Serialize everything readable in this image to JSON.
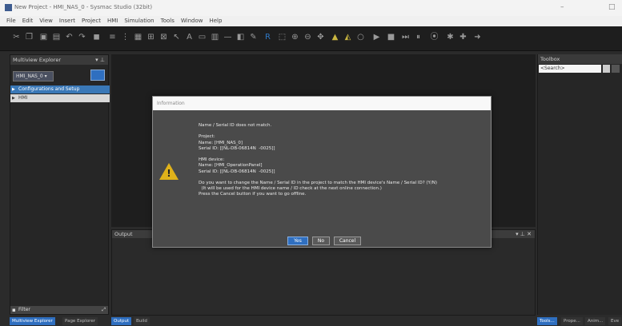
{
  "window": {
    "title": "New Project - HMI_NAS_0 - Sysmac Studio (32bit)",
    "minimize": "–",
    "close": "□"
  },
  "menu": [
    "File",
    "Edit",
    "View",
    "Insert",
    "Project",
    "HMI",
    "Simulation",
    "Tools",
    "Window",
    "Help"
  ],
  "toolbar_icons": [
    "cut-icon",
    "copy-icon",
    "paste-icon",
    "delete-icon",
    "undo-icon",
    "redo-icon",
    "save-icon",
    "align-icon",
    "grid-icon",
    "layout-icon",
    "distribute-icon",
    "group-icon",
    "arrow-icon",
    "text-icon",
    "image-icon",
    "table-icon",
    "line-icon",
    "shape-icon",
    "tool-icon",
    "select-icon",
    "zoom-icon",
    "zoom-in-icon",
    "zoom-out-icon",
    "pan-icon",
    "warning-icon",
    "flag-icon",
    "circle-icon",
    "run-icon",
    "stop-icon",
    "step-icon",
    "pause-icon",
    "breakpoint-icon",
    "settings-icon",
    "more-icon",
    "connect-icon"
  ],
  "left_pane": {
    "title": "Multiview Explorer",
    "device": "HMI_NAS_0 ▾",
    "tree": {
      "config": "Configurations and Setup",
      "hmi": "HMI"
    },
    "filter": "Filter"
  },
  "left_tabs": [
    "Multiview Explorer",
    "Page Explorer"
  ],
  "center_tabs": [
    "Output",
    "Build"
  ],
  "output": {
    "title": "Output"
  },
  "toolbox": {
    "title": "Toolbox",
    "search_placeholder": "<Search>"
  },
  "right_tabs": [
    "Tools...",
    "Prope...",
    "Anim...",
    "Eve"
  ],
  "dialog": {
    "title": "Information",
    "message": "Name / Serial ID does not match.\n\nProject:\nName: [HMI_NAS_0]\nSerial ID: [[NL-DB-06814N  -0025]]\n\nHMI device:\nName: [HMI_OperationPanel]\nSerial ID: [[NL-DB-06814N  -0025]]\n\nDo you want to change the Name / Serial ID in the project to match the HMI device's Name / Serial ID? (Y/N)\n  (It will be used for the HMI device name / ID check at the next online connection.)\nPress the Cancel button if you want to go offline.",
    "buttons": {
      "yes": "Yes",
      "no": "No",
      "cancel": "Cancel"
    }
  },
  "colors": {
    "accent": "#2f6fc0",
    "warning": "#e0b21a",
    "background": "#2b2b2b"
  }
}
